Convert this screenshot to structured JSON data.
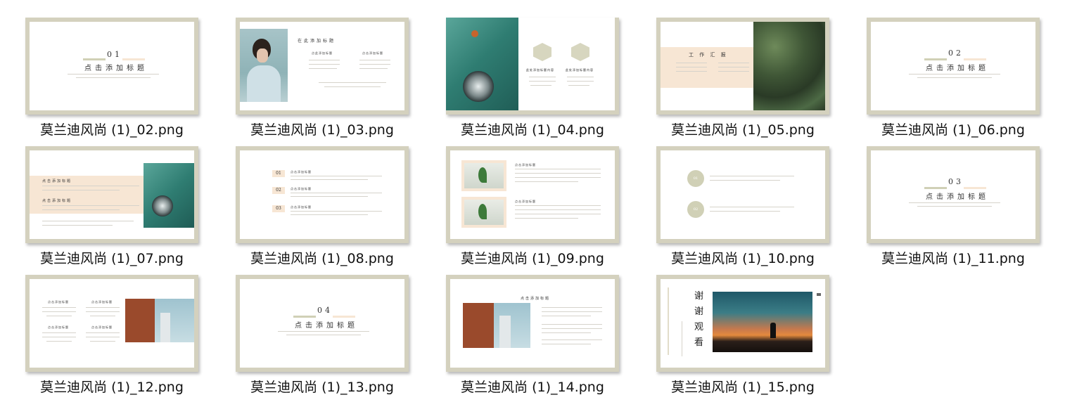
{
  "files": [
    {
      "name": "莫兰迪风尚 (1)_02.png",
      "num": "01",
      "title": "点击添加标题"
    },
    {
      "name": "莫兰迪风尚 (1)_03.png",
      "title": "在此添加标题",
      "sub1": "点此添加标题",
      "sub2": "点击添加标题"
    },
    {
      "name": "莫兰迪风尚 (1)_04.png",
      "sub1": "此处添加标题内容",
      "sub2": "此处添加标题内容"
    },
    {
      "name": "莫兰迪风尚 (1)_05.png",
      "title": "工 作 汇 报"
    },
    {
      "name": "莫兰迪风尚 (1)_06.png",
      "num": "02",
      "title": "点击添加标题"
    },
    {
      "name": "莫兰迪风尚 (1)_07.png",
      "sub1": "点击添加标题",
      "sub2": "点击添加标题"
    },
    {
      "name": "莫兰迪风尚 (1)_08.png",
      "n1": "01",
      "n2": "02",
      "n3": "03",
      "sub1": "点击添加标题",
      "sub2": "点击添加标题",
      "sub3": "点击添加标题"
    },
    {
      "name": "莫兰迪风尚 (1)_09.png",
      "sub1": "点击添加标题",
      "sub2": "点击添加标题"
    },
    {
      "name": "莫兰迪风尚 (1)_10.png",
      "n1": "01",
      "n2": "02"
    },
    {
      "name": "莫兰迪风尚 (1)_11.png",
      "num": "03",
      "title": "点击添加标题"
    },
    {
      "name": "莫兰迪风尚 (1)_12.png",
      "sub1": "点击添加标题",
      "sub2": "点击添加标题",
      "sub3": "点击添加标题",
      "sub4": "点击添加标题"
    },
    {
      "name": "莫兰迪风尚 (1)_13.png",
      "num": "04",
      "title": "点击添加标题"
    },
    {
      "name": "莫兰迪风尚 (1)_14.png",
      "title": "点击添加标题"
    },
    {
      "name": "莫兰迪风尚 (1)_15.png",
      "thanks": [
        "谢",
        "谢",
        "观",
        "看"
      ]
    }
  ],
  "colors": {
    "frame": "#d4d1be",
    "peach": "#f7e6d4",
    "sage": "#d0d0b6",
    "teal": "#2f7d72"
  }
}
